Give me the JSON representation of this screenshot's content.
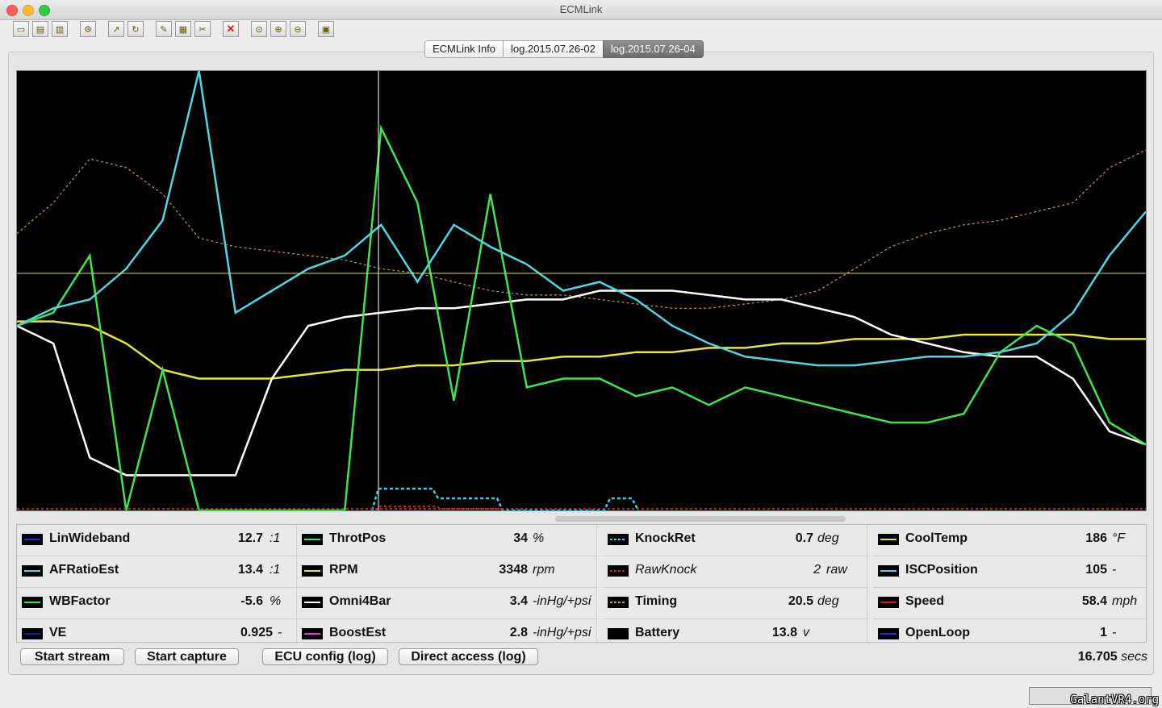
{
  "window": {
    "title": "ECMLink"
  },
  "toolbar": {
    "buttons": [
      {
        "icon": "open-folder-icon",
        "glyph": "▭"
      },
      {
        "icon": "save-icon",
        "glyph": "▤"
      },
      {
        "icon": "save-as-icon",
        "glyph": "▥"
      },
      {
        "icon": "settings-icon",
        "glyph": "⚙"
      },
      {
        "icon": "export-icon",
        "glyph": "↗"
      },
      {
        "icon": "refresh-icon",
        "glyph": "↻"
      },
      {
        "icon": "edit-icon",
        "glyph": "✎"
      },
      {
        "icon": "table-icon",
        "glyph": "▦"
      },
      {
        "icon": "tools-icon",
        "glyph": "✂"
      },
      {
        "icon": "close-icon",
        "glyph": "✕"
      },
      {
        "icon": "zoom-reset-icon",
        "glyph": "⊙"
      },
      {
        "icon": "zoom-in-icon",
        "glyph": "⊕"
      },
      {
        "icon": "zoom-out-icon",
        "glyph": "⊖"
      },
      {
        "icon": "map-icon",
        "glyph": "▣"
      }
    ]
  },
  "tabs": [
    {
      "label": "ECMLink Info",
      "active": false
    },
    {
      "label": "log.2015.07.26-02",
      "active": false
    },
    {
      "label": "log.2015.07.26-04",
      "active": true
    }
  ],
  "params": [
    {
      "name": "LinWideband",
      "value": "12.7",
      "unit": ":1",
      "color": "#2b2bd6",
      "style": "solid"
    },
    {
      "name": "AFRatioEst",
      "value": "13.4",
      "unit": ":1",
      "color": "#4fd6e6",
      "style": "solid"
    },
    {
      "name": "WBFactor",
      "value": "-5.6",
      "unit": "%",
      "color": "#3ee64a",
      "style": "solid"
    },
    {
      "name": "VE",
      "value": "0.925",
      "unit": "-",
      "color": "#1a1aa0",
      "style": "solid"
    },
    {
      "name": "ThrotPos",
      "value": "34",
      "unit": "%",
      "color": "#3ee64a",
      "style": "solid"
    },
    {
      "name": "RPM",
      "value": "3348",
      "unit": "rpm",
      "color": "#e6e639",
      "style": "solid"
    },
    {
      "name": "Omni4Bar",
      "value": "3.4",
      "unit": "-inHg/+psi",
      "color": "#ffffff",
      "style": "solid"
    },
    {
      "name": "BoostEst",
      "value": "2.8",
      "unit": "-inHg/+psi",
      "color": "#e03ee0",
      "style": "solid"
    },
    {
      "name": "KnockRet",
      "value": "0.7",
      "unit": "deg",
      "color": "#2ad6f0",
      "style": "dashed"
    },
    {
      "name": "RawKnock",
      "value": "2",
      "unit": "raw",
      "color": "#d02020",
      "style": "dashed"
    },
    {
      "name": "Timing",
      "value": "20.5",
      "unit": "deg",
      "color": "#c8a030",
      "style": "dashed"
    },
    {
      "name": "Battery",
      "value": "13.8",
      "unit": "v",
      "color": "#000000",
      "style": "solid"
    },
    {
      "name": "CoolTemp",
      "value": "186",
      "unit": "°F",
      "color": "#e6e639",
      "style": "solid"
    },
    {
      "name": "ISCPosition",
      "value": "105",
      "unit": "-",
      "color": "#4fd6e6",
      "style": "solid"
    },
    {
      "name": "Speed",
      "value": "58.4",
      "unit": "mph",
      "color": "#d02020",
      "style": "solid"
    },
    {
      "name": "OpenLoop",
      "value": "1",
      "unit": "-",
      "color": "#2b2bd6",
      "style": "solid"
    }
  ],
  "buttons": {
    "start_stream": "Start stream",
    "start_capture": "Start capture",
    "ecu_config": "ECU config (log)",
    "direct_access": "Direct access (log)"
  },
  "time": {
    "value": "16.705",
    "unit": "secs"
  },
  "watermark": "GalantVR4.org",
  "chart_data": {
    "type": "line",
    "title": "",
    "xlabel": "",
    "ylabel": "",
    "series": [
      {
        "name": "AFRatioEst",
        "values": [
          0.42,
          0.46,
          0.48,
          0.55,
          0.66,
          1.0,
          0.45,
          0.5,
          0.55,
          0.58,
          0.65,
          0.52,
          0.65,
          0.6,
          0.56,
          0.5,
          0.52,
          0.48,
          0.42,
          0.38,
          0.35,
          0.34,
          0.33,
          0.33,
          0.34,
          0.35,
          0.35,
          0.36,
          0.38,
          0.45,
          0.58,
          0.68
        ]
      },
      {
        "name": "ThrotPos",
        "values": [
          0.42,
          0.45,
          0.58,
          0.0,
          0.32,
          0.0,
          0.0,
          0.0,
          0.0,
          0.0,
          0.87,
          0.7,
          0.25,
          0.72,
          0.28,
          0.3,
          0.3,
          0.26,
          0.28,
          0.24,
          0.28,
          0.26,
          0.24,
          0.22,
          0.2,
          0.2,
          0.22,
          0.36,
          0.42,
          0.38,
          0.2,
          0.15
        ]
      },
      {
        "name": "Omni4Bar",
        "values": [
          0.42,
          0.38,
          0.12,
          0.08,
          0.08,
          0.08,
          0.08,
          0.3,
          0.42,
          0.44,
          0.45,
          0.46,
          0.46,
          0.47,
          0.48,
          0.48,
          0.5,
          0.5,
          0.5,
          0.49,
          0.48,
          0.48,
          0.46,
          0.44,
          0.4,
          0.38,
          0.36,
          0.35,
          0.35,
          0.3,
          0.18,
          0.15
        ]
      },
      {
        "name": "RPM",
        "values": [
          0.43,
          0.43,
          0.42,
          0.38,
          0.32,
          0.3,
          0.3,
          0.3,
          0.31,
          0.32,
          0.32,
          0.33,
          0.33,
          0.34,
          0.34,
          0.35,
          0.35,
          0.36,
          0.36,
          0.37,
          0.37,
          0.38,
          0.38,
          0.39,
          0.39,
          0.39,
          0.4,
          0.4,
          0.4,
          0.4,
          0.39,
          0.39
        ]
      },
      {
        "name": "Timing",
        "values": [
          0.63,
          0.7,
          0.8,
          0.78,
          0.72,
          0.62,
          0.6,
          0.59,
          0.58,
          0.57,
          0.55,
          0.54,
          0.52,
          0.5,
          0.49,
          0.49,
          0.48,
          0.47,
          0.46,
          0.46,
          0.47,
          0.48,
          0.5,
          0.55,
          0.6,
          0.63,
          0.65,
          0.66,
          0.68,
          0.7,
          0.78,
          0.82
        ]
      }
    ]
  }
}
